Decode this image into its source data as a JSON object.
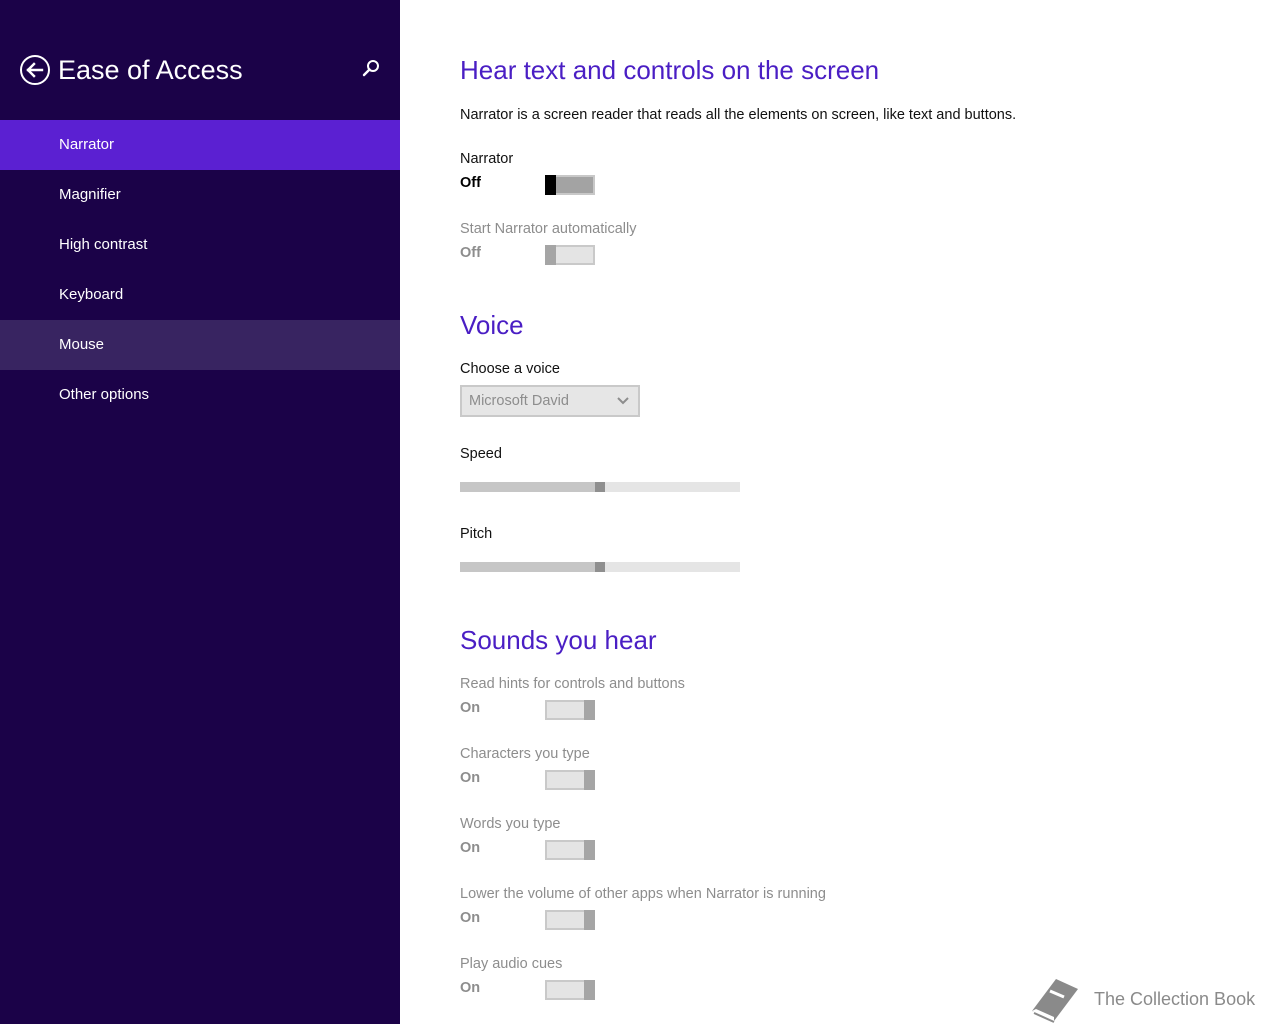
{
  "sidebar": {
    "title": "Ease of Access",
    "back_icon": "back-arrow-icon",
    "search_icon": "search-icon",
    "items": [
      {
        "label": "Narrator"
      },
      {
        "label": "Magnifier"
      },
      {
        "label": "High contrast"
      },
      {
        "label": "Keyboard"
      },
      {
        "label": "Mouse"
      },
      {
        "label": "Other options"
      }
    ],
    "selected_item": "Narrator",
    "hovered_item": "Mouse"
  },
  "main": {
    "section1": {
      "heading": "Hear text and controls on the screen",
      "description": "Narrator is a screen reader that reads all the elements on screen, like text and buttons.",
      "narrator": {
        "label": "Narrator",
        "state": "Off",
        "enabled": true
      },
      "start_auto": {
        "label": "Start Narrator automatically",
        "state": "Off",
        "enabled": false
      }
    },
    "voice": {
      "heading": "Voice",
      "choose_label": "Choose a voice",
      "selected_voice": "Microsoft David",
      "speed": {
        "label": "Speed",
        "value": 0.5
      },
      "pitch": {
        "label": "Pitch",
        "value": 0.5
      }
    },
    "sounds": {
      "heading": "Sounds you hear",
      "items": [
        {
          "label": "Read hints for controls and buttons",
          "state": "On"
        },
        {
          "label": "Characters you type",
          "state": "On"
        },
        {
          "label": "Words you type",
          "state": "On"
        },
        {
          "label": "Lower the volume of other apps when Narrator is running",
          "state": "On"
        },
        {
          "label": "Play audio cues",
          "state": "On"
        }
      ]
    }
  },
  "watermark": {
    "text": "The Collection Book"
  },
  "colors": {
    "sidebar_bg": "#1b0248",
    "selected_bg": "#5b20d2",
    "hover_bg": "#382461",
    "heading": "#4a1ec4"
  }
}
